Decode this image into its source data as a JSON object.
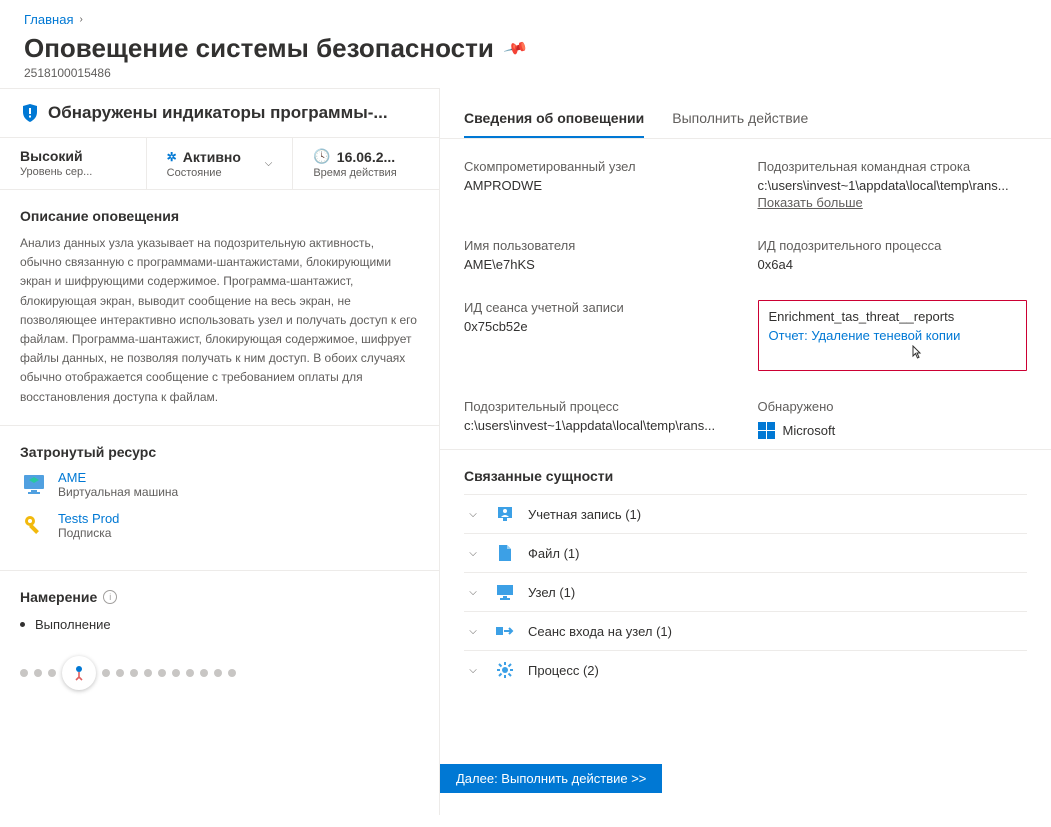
{
  "breadcrumb": {
    "home": "Главная"
  },
  "page": {
    "title": "Оповещение системы безопасности",
    "id": "2518100015486"
  },
  "alert": {
    "name": "Обнаружены индикаторы программы-...",
    "severity": {
      "value": "Высокий",
      "label": "Уровень сер..."
    },
    "state": {
      "value": "Активно",
      "label": "Состояние"
    },
    "time": {
      "value": "16.06.2...",
      "label": "Время действия"
    }
  },
  "description": {
    "title": "Описание оповещения",
    "body": "Анализ данных узла указывает на подозрительную активность, обычно связанную с программами-шантажистами, блокирующими экран и шифрующими содержимое. Программа-шантажист, блокирующая экран, выводит сообщение на весь экран, не позволяющее интерактивно использовать узел и получать доступ к его файлам. Программа-шантажист, блокирующая содержимое, шифрует файлы данных, не позволяя получать к ним доступ. В обоих случаях обычно отображается сообщение с требованием оплаты для восстановления доступа к файлам."
  },
  "affected": {
    "title": "Затронутый ресурс",
    "items": [
      {
        "name": "AME",
        "type": "Виртуальная машина",
        "icon": "vm"
      },
      {
        "name": "Tests Prod",
        "type": "Подписка",
        "icon": "key"
      }
    ]
  },
  "intent": {
    "title": "Намерение",
    "item": "Выполнение"
  },
  "tabs": {
    "details": "Сведения об оповещении",
    "action": "Выполнить действие"
  },
  "fields": {
    "compromised_host": {
      "label": "Скомпрометированный узел",
      "value": "AMPRODWE"
    },
    "suspicious_cmdline": {
      "label": "Подозрительная командная строка",
      "value": "c:\\users\\invest~1\\appdata\\local\\temp\\rans...",
      "show_more": "Показать больше"
    },
    "username": {
      "label": "Имя пользователя",
      "value": "AME\\e7hKS"
    },
    "process_id": {
      "label": "ИД подозрительного процесса",
      "value": "0x6a4"
    },
    "session_id": {
      "label": "ИД сеанса учетной записи",
      "value": "0x75cb52e"
    },
    "enrichment": {
      "label": "Enrichment_tas_threat__reports",
      "link": "Отчет: Удаление теневой копии"
    },
    "suspicious_process": {
      "label": "Подозрительный процесс",
      "value": "c:\\users\\invest~1\\appdata\\local\\temp\\rans..."
    },
    "detected_by": {
      "label": "Обнаружено",
      "value": "Microsoft"
    }
  },
  "entities": {
    "title": "Связанные сущности",
    "items": [
      {
        "label": "Учетная запись (1)",
        "icon": "account"
      },
      {
        "label": "Файл (1)",
        "icon": "file"
      },
      {
        "label": "Узел (1)",
        "icon": "host"
      },
      {
        "label": "Сеанс входа на узел (1)",
        "icon": "session"
      },
      {
        "label": "Процесс (2)",
        "icon": "process"
      }
    ]
  },
  "footer": {
    "next": "Далее: Выполнить действие >>"
  }
}
